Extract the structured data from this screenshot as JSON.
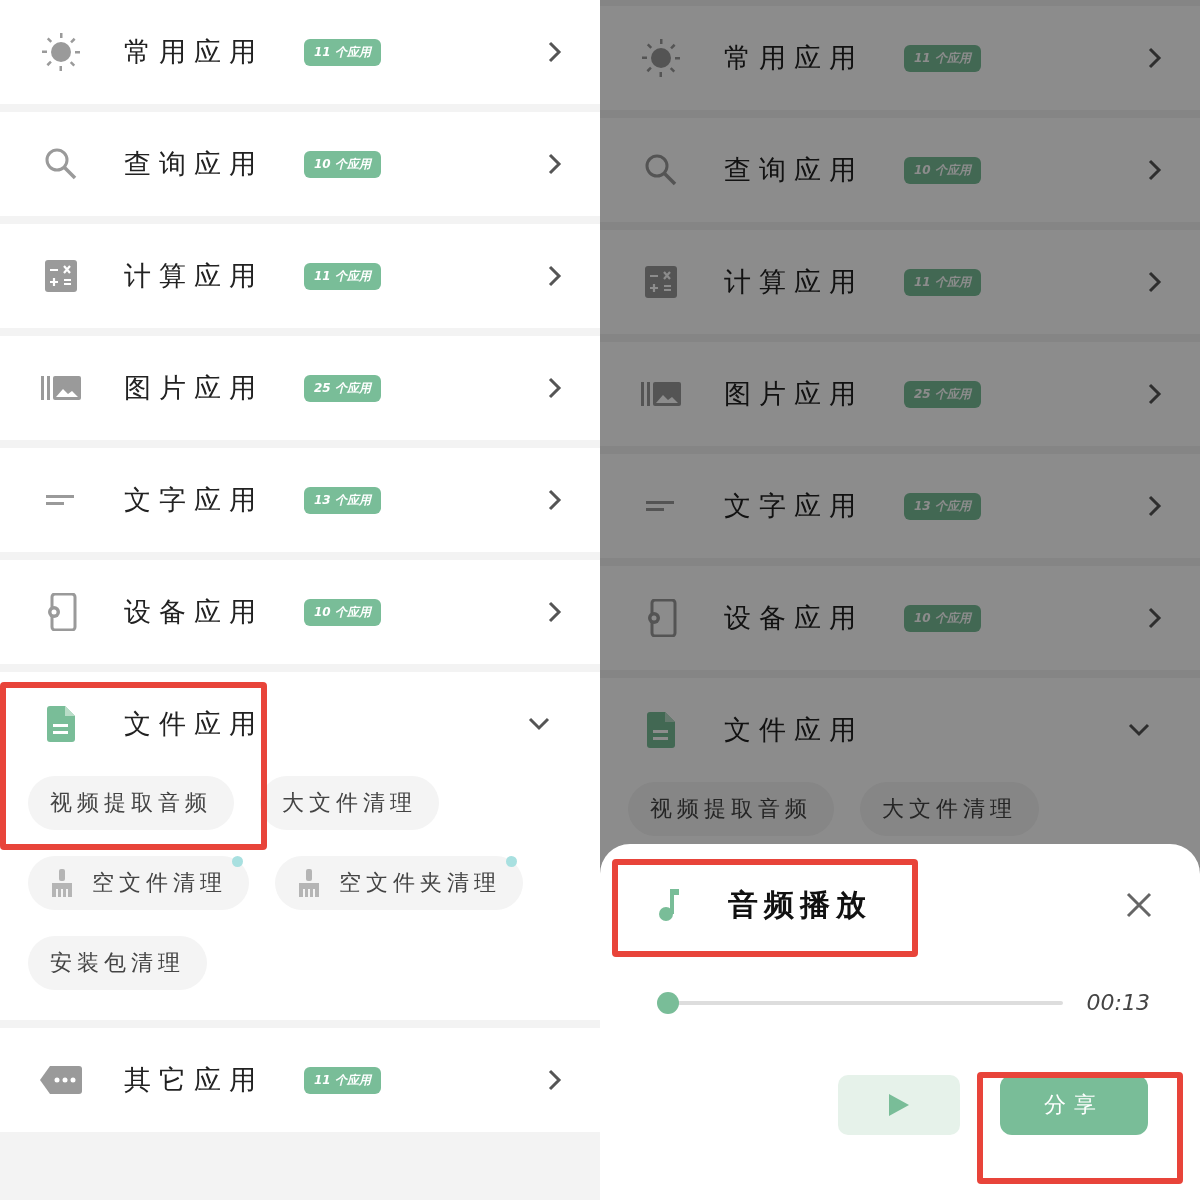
{
  "panels": [
    {
      "dimmed": false,
      "categories": [
        {
          "title": "常用应用",
          "badge": "11 个应用",
          "expanded": false
        },
        {
          "title": "查询应用",
          "badge": "10 个应用",
          "expanded": false
        },
        {
          "title": "计算应用",
          "badge": "11 个应用",
          "expanded": false
        },
        {
          "title": "图片应用",
          "badge": "25 个应用",
          "expanded": false
        },
        {
          "title": "文字应用",
          "badge": "13 个应用",
          "expanded": false
        },
        {
          "title": "设备应用",
          "badge": "10 个应用",
          "expanded": false
        },
        {
          "title": "文件应用",
          "expanded": true,
          "highlighted": true,
          "chips": [
            {
              "label": "视频提取音频",
              "kind": "plain",
              "new": false
            },
            {
              "label": "大文件清理",
              "kind": "plain",
              "new": false
            },
            {
              "label": "空文件清理",
              "kind": "cleaner",
              "new": true
            },
            {
              "label": "空文件夹清理",
              "kind": "cleaner",
              "new": true
            },
            {
              "label": "安装包清理",
              "kind": "plain",
              "new": false
            }
          ]
        },
        {
          "title": "其它应用",
          "badge": "11 个应用",
          "expanded": false
        }
      ]
    },
    {
      "dimmed": true,
      "categories": [
        {
          "title": "常用应用",
          "badge": "11 个应用",
          "expanded": false
        },
        {
          "title": "查询应用",
          "badge": "10 个应用",
          "expanded": false
        },
        {
          "title": "计算应用",
          "badge": "11 个应用",
          "expanded": false
        },
        {
          "title": "图片应用",
          "badge": "25 个应用",
          "expanded": false
        },
        {
          "title": "文字应用",
          "badge": "13 个应用",
          "expanded": false
        },
        {
          "title": "设备应用",
          "badge": "10 个应用",
          "expanded": false
        },
        {
          "title": "文件应用",
          "expanded": true,
          "highlighted": false,
          "chips": [
            {
              "label": "视频提取音频",
              "kind": "plain",
              "new": false
            },
            {
              "label": "大文件清理",
              "kind": "plain",
              "new": false
            }
          ]
        }
      ],
      "sheet": {
        "title": "音频播放",
        "title_highlighted": true,
        "level": 0,
        "time": "00:13",
        "share": "分享",
        "share_highlighted": true
      }
    }
  ]
}
